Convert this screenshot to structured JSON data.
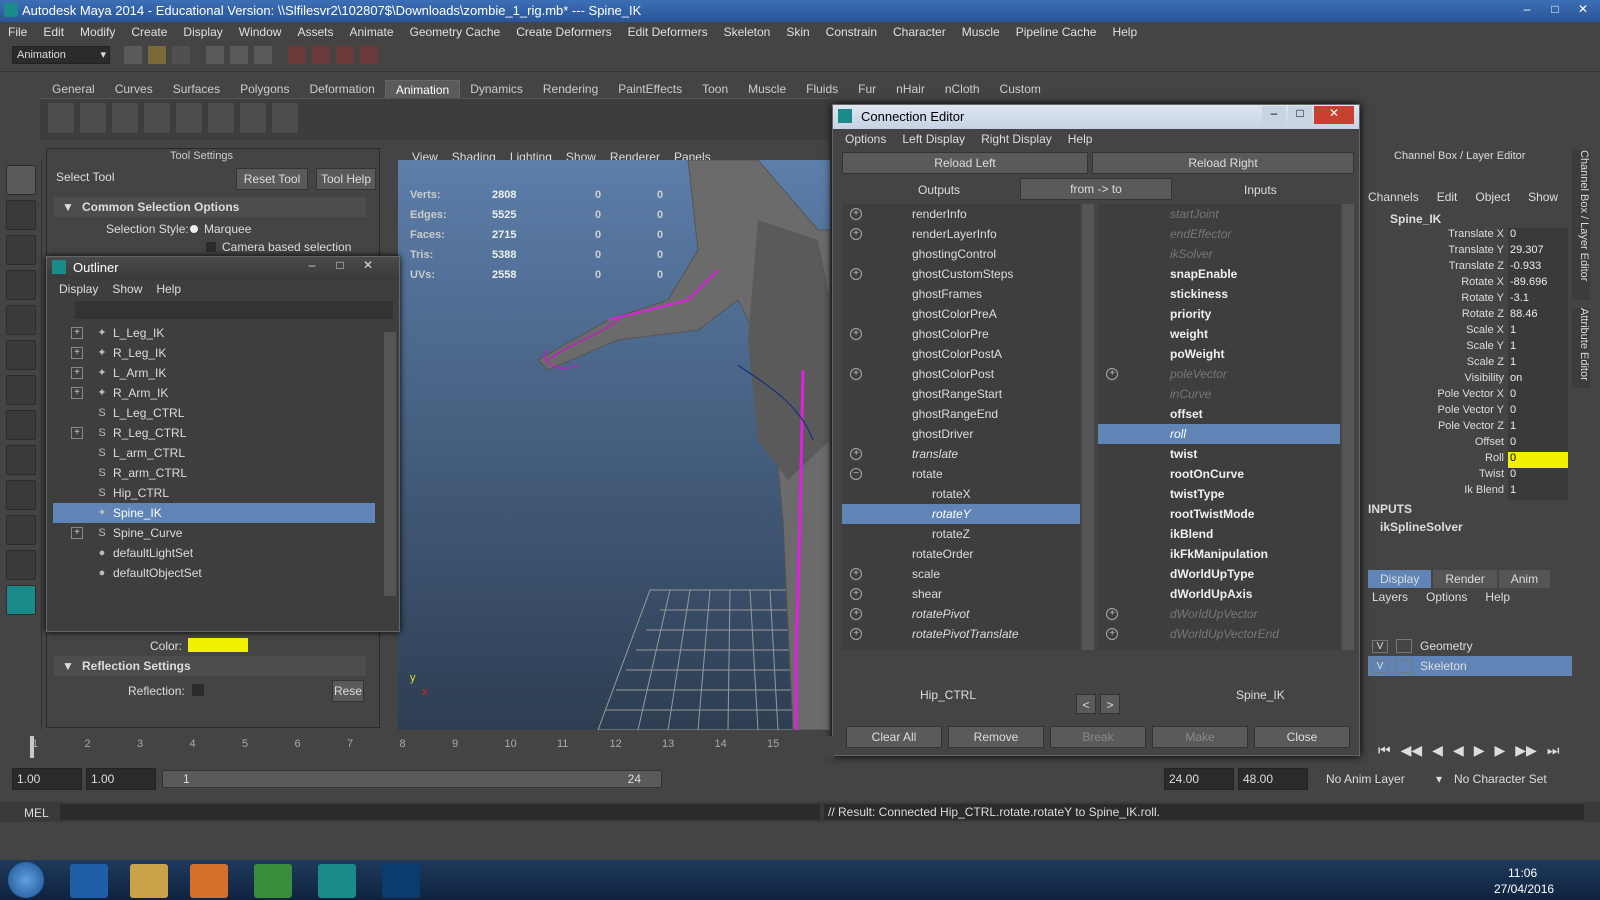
{
  "window": {
    "title": "Autodesk Maya 2014 - Educational Version: \\\\Slfilesvr2\\102807$\\Downloads\\zombie_1_rig.mb*   ---   Spine_IK"
  },
  "menubar": [
    "File",
    "Edit",
    "Modify",
    "Create",
    "Display",
    "Window",
    "Assets",
    "Animate",
    "Geometry Cache",
    "Create Deformers",
    "Edit Deformers",
    "Skeleton",
    "Skin",
    "Constrain",
    "Character",
    "Muscle",
    "Pipeline Cache",
    "Help"
  ],
  "mode_dropdown": "Animation",
  "shelf_tabs": [
    "General",
    "Curves",
    "Surfaces",
    "Polygons",
    "Deformation",
    "Animation",
    "Dynamics",
    "Rendering",
    "PaintEffects",
    "Toon",
    "Muscle",
    "Fluids",
    "Fur",
    "nHair",
    "nCloth",
    "Custom"
  ],
  "shelf_active": "Animation",
  "tool_settings": {
    "title": "Tool Settings",
    "tool_name": "Select Tool",
    "reset_label": "Reset Tool",
    "help_label": "Tool Help",
    "section1": "Common Selection Options",
    "selection_style_label": "Selection Style:",
    "selection_style_value": "Marquee",
    "camera_label": "Camera based selection",
    "color_label": "Color:",
    "reflection_section": "Reflection Settings",
    "reflection_label": "Reflection:",
    "reset_short": "Rese"
  },
  "viewport": {
    "menu": [
      "View",
      "Shading",
      "Lighting",
      "Show",
      "Renderer",
      "Panels"
    ],
    "hud": [
      {
        "k": "Verts:",
        "v": "2808",
        "a": "0",
        "b": "0"
      },
      {
        "k": "Edges:",
        "v": "5525",
        "a": "0",
        "b": "0"
      },
      {
        "k": "Faces:",
        "v": "2715",
        "a": "0",
        "b": "0"
      },
      {
        "k": "Tris:",
        "v": "5388",
        "a": "0",
        "b": "0"
      },
      {
        "k": "UVs:",
        "v": "2558",
        "a": "0",
        "b": "0"
      }
    ],
    "axis_y": "y",
    "axis_x": "x"
  },
  "outliner": {
    "title": "Outliner",
    "menu": [
      "Display",
      "Show",
      "Help"
    ],
    "items": [
      {
        "label": "L_Leg_IK",
        "plus": true,
        "icon": "ik"
      },
      {
        "label": "R_Leg_IK",
        "plus": true,
        "icon": "ik"
      },
      {
        "label": "L_Arm_IK",
        "plus": true,
        "icon": "ik"
      },
      {
        "label": "R_Arm_IK",
        "plus": true,
        "icon": "ik"
      },
      {
        "label": "L_Leg_CTRL",
        "plus": false,
        "icon": "curve"
      },
      {
        "label": "R_Leg_CTRL",
        "plus": true,
        "icon": "curve"
      },
      {
        "label": "L_arm_CTRL",
        "plus": false,
        "icon": "curve"
      },
      {
        "label": "R_arm_CTRL",
        "plus": false,
        "icon": "curve"
      },
      {
        "label": "Hip_CTRL",
        "plus": false,
        "icon": "curve"
      },
      {
        "label": "Spine_IK",
        "plus": false,
        "icon": "ik",
        "selected": true
      },
      {
        "label": "Spine_Curve",
        "plus": true,
        "icon": "curve"
      },
      {
        "label": "defaultLightSet",
        "plus": false,
        "icon": "set"
      },
      {
        "label": "defaultObjectSet",
        "plus": false,
        "icon": "set"
      }
    ]
  },
  "connection_editor": {
    "title": "Connection Editor",
    "menu": [
      "Options",
      "Left Display",
      "Right Display",
      "Help"
    ],
    "reload_left": "Reload Left",
    "reload_right": "Reload Right",
    "outputs_label": "Outputs",
    "direction_label": "from -> to",
    "inputs_label": "Inputs",
    "left_attrs": [
      {
        "t": "renderInfo",
        "p": true
      },
      {
        "t": "renderLayerInfo",
        "p": true
      },
      {
        "t": "ghostingControl"
      },
      {
        "t": "ghostCustomSteps",
        "p": true
      },
      {
        "t": "ghostFrames"
      },
      {
        "t": "ghostColorPreA"
      },
      {
        "t": "ghostColorPre",
        "p": true
      },
      {
        "t": "ghostColorPostA"
      },
      {
        "t": "ghostColorPost",
        "p": true
      },
      {
        "t": "ghostRangeStart"
      },
      {
        "t": "ghostRangeEnd"
      },
      {
        "t": "ghostDriver"
      },
      {
        "t": "translate",
        "p": true,
        "s": "it"
      },
      {
        "t": "rotate",
        "m": true
      },
      {
        "t": "rotateX",
        "i": true
      },
      {
        "t": "rotateY",
        "i": true,
        "s": "sel it"
      },
      {
        "t": "rotateZ",
        "i": true
      },
      {
        "t": "rotateOrder"
      },
      {
        "t": "scale",
        "p": true
      },
      {
        "t": "shear",
        "p": true
      },
      {
        "t": "rotatePivot",
        "p": true,
        "s": "it"
      },
      {
        "t": "rotatePivotTranslate",
        "p": true,
        "s": "it"
      }
    ],
    "right_attrs": [
      {
        "t": "startJoint",
        "s": "dim"
      },
      {
        "t": "endEffector",
        "s": "dim"
      },
      {
        "t": "ikSolver",
        "s": "dim"
      },
      {
        "t": "snapEnable",
        "s": "b"
      },
      {
        "t": "stickiness",
        "s": "b"
      },
      {
        "t": "priority",
        "s": "b"
      },
      {
        "t": "weight",
        "s": "b"
      },
      {
        "t": "poWeight",
        "s": "b"
      },
      {
        "t": "poleVector",
        "s": "dim",
        "p": true
      },
      {
        "t": "inCurve",
        "s": "dim"
      },
      {
        "t": "offset",
        "s": "b"
      },
      {
        "t": "roll",
        "s": "sel it"
      },
      {
        "t": "twist",
        "s": "b"
      },
      {
        "t": "rootOnCurve",
        "s": "b"
      },
      {
        "t": "twistType",
        "s": "b"
      },
      {
        "t": "rootTwistMode",
        "s": "b"
      },
      {
        "t": "ikBlend",
        "s": "b"
      },
      {
        "t": "ikFkManipulation",
        "s": "b"
      },
      {
        "t": "dWorldUpType",
        "s": "b"
      },
      {
        "t": "dWorldUpAxis",
        "s": "b"
      },
      {
        "t": "dWorldUpVector",
        "s": "dim",
        "p": true
      },
      {
        "t": "dWorldUpVectorEnd",
        "s": "dim",
        "p": true
      }
    ],
    "left_node": "Hip_CTRL",
    "right_node": "Spine_IK",
    "prev": "<",
    "next": ">",
    "buttons": [
      "Clear All",
      "Remove",
      "Break",
      "Make",
      "Close"
    ]
  },
  "channel_box": {
    "title": "Channel Box / Layer Editor",
    "menu": [
      "Channels",
      "Edit",
      "Object",
      "Show"
    ],
    "node": "Spine_IK",
    "channels": [
      {
        "l": "Translate X",
        "v": "0"
      },
      {
        "l": "Translate Y",
        "v": "29.307"
      },
      {
        "l": "Translate Z",
        "v": "-0.933"
      },
      {
        "l": "Rotate X",
        "v": "-89.696"
      },
      {
        "l": "Rotate Y",
        "v": "-3.1"
      },
      {
        "l": "Rotate Z",
        "v": "88.46"
      },
      {
        "l": "Scale X",
        "v": "1"
      },
      {
        "l": "Scale Y",
        "v": "1"
      },
      {
        "l": "Scale Z",
        "v": "1"
      },
      {
        "l": "Visibility",
        "v": "on"
      },
      {
        "l": "Pole Vector X",
        "v": "0"
      },
      {
        "l": "Pole Vector Y",
        "v": "0"
      },
      {
        "l": "Pole Vector Z",
        "v": "1"
      },
      {
        "l": "Offset",
        "v": "0"
      },
      {
        "l": "Roll",
        "v": "0",
        "hl": true
      },
      {
        "l": "Twist",
        "v": "0"
      },
      {
        "l": "Ik Blend",
        "v": "1"
      }
    ],
    "inputs_label": "INPUTS",
    "solver": "ikSplineSolver",
    "layer_tabs": [
      "Display",
      "Render",
      "Anim"
    ],
    "layer_menu": [
      "Layers",
      "Options",
      "Help"
    ],
    "layers": [
      {
        "v": "V",
        "name": "Geometry"
      },
      {
        "v": "V",
        "name": "Skeleton",
        "selected": true
      }
    ],
    "side_tabs": [
      "Channel Box / Layer Editor",
      "Attribute Editor"
    ]
  },
  "timeline": {
    "ticks": [
      "1",
      "2",
      "3",
      "4",
      "5",
      "6",
      "7",
      "8",
      "9",
      "10",
      "11",
      "12",
      "13",
      "14",
      "15"
    ]
  },
  "range": {
    "start": "1.00",
    "start2": "1.00",
    "range_start": "1",
    "range_end": "24",
    "end": "24.00",
    "end2": "48.00",
    "anim_layer": "No Anim Layer",
    "char_set": "No Character Set"
  },
  "command": {
    "label": "MEL",
    "result": "// Result: Connected Hip_CTRL.rotate.rotateY to Spine_IK.roll."
  },
  "taskbar": {
    "time": "11:06",
    "date": "27/04/2016"
  },
  "colors": {
    "selection": "#5f84b5",
    "yellow": "#f2f200",
    "magenta": "#d020d0"
  }
}
